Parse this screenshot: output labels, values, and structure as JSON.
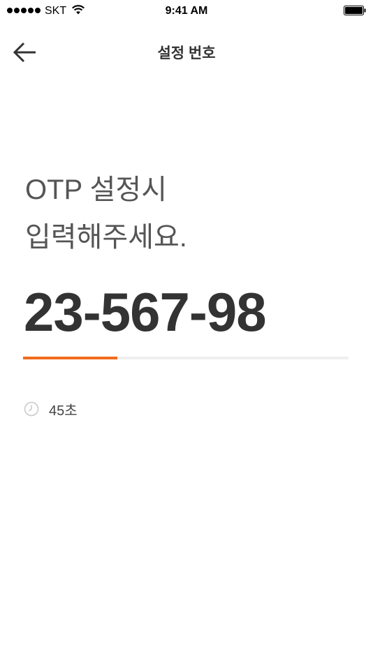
{
  "status_bar": {
    "carrier": "SKT",
    "time": "9:41 AM",
    "signal_icon": "signal-dots-icon",
    "wifi_icon": "wifi-icon",
    "battery_icon": "battery-icon"
  },
  "header": {
    "back_icon": "arrow-left-icon",
    "title": "설정 번호"
  },
  "instruction": {
    "line1": "OTP 설정시",
    "line2": "입력해주세요."
  },
  "otp": {
    "code": "23-567-98"
  },
  "progress": {
    "fraction": 0.29,
    "fill_color": "#f26b1d",
    "track_color": "#efefef"
  },
  "timer": {
    "icon": "clock-icon",
    "text": "45초"
  }
}
